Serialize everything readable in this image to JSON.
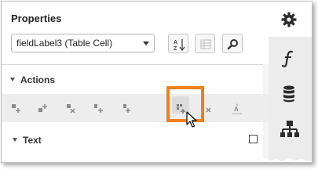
{
  "panel": {
    "title": "Properties",
    "field_select": {
      "value": "fieldLabel3 (Table Cell)"
    }
  },
  "toolbar": {
    "buttons": [
      {
        "icon": "sort-az-icon"
      },
      {
        "icon": "grid-view-icon"
      },
      {
        "icon": "search-icon"
      }
    ]
  },
  "right_rail": {
    "items": [
      {
        "icon": "gear-icon"
      },
      {
        "icon": "function-icon"
      },
      {
        "icon": "database-icon"
      },
      {
        "icon": "hierarchy-icon"
      }
    ]
  },
  "sections": {
    "actions_label": "Actions",
    "text_label": "Text"
  },
  "actions": {
    "items": [
      {
        "icon": "insert-row-above-icon"
      },
      {
        "icon": "insert-row-below-icon"
      },
      {
        "icon": "delete-row-icon"
      },
      {
        "icon": "insert-column-left-icon"
      },
      {
        "icon": "insert-column-right-icon"
      },
      {
        "icon": "add-cell-icon",
        "highlighted": true
      },
      {
        "icon": "delete-column-icon"
      },
      {
        "icon": "text-format-icon"
      }
    ]
  },
  "colors": {
    "highlight": "#f07f1c",
    "rail_bg": "#ececec",
    "icon": "#8a8a8a"
  }
}
